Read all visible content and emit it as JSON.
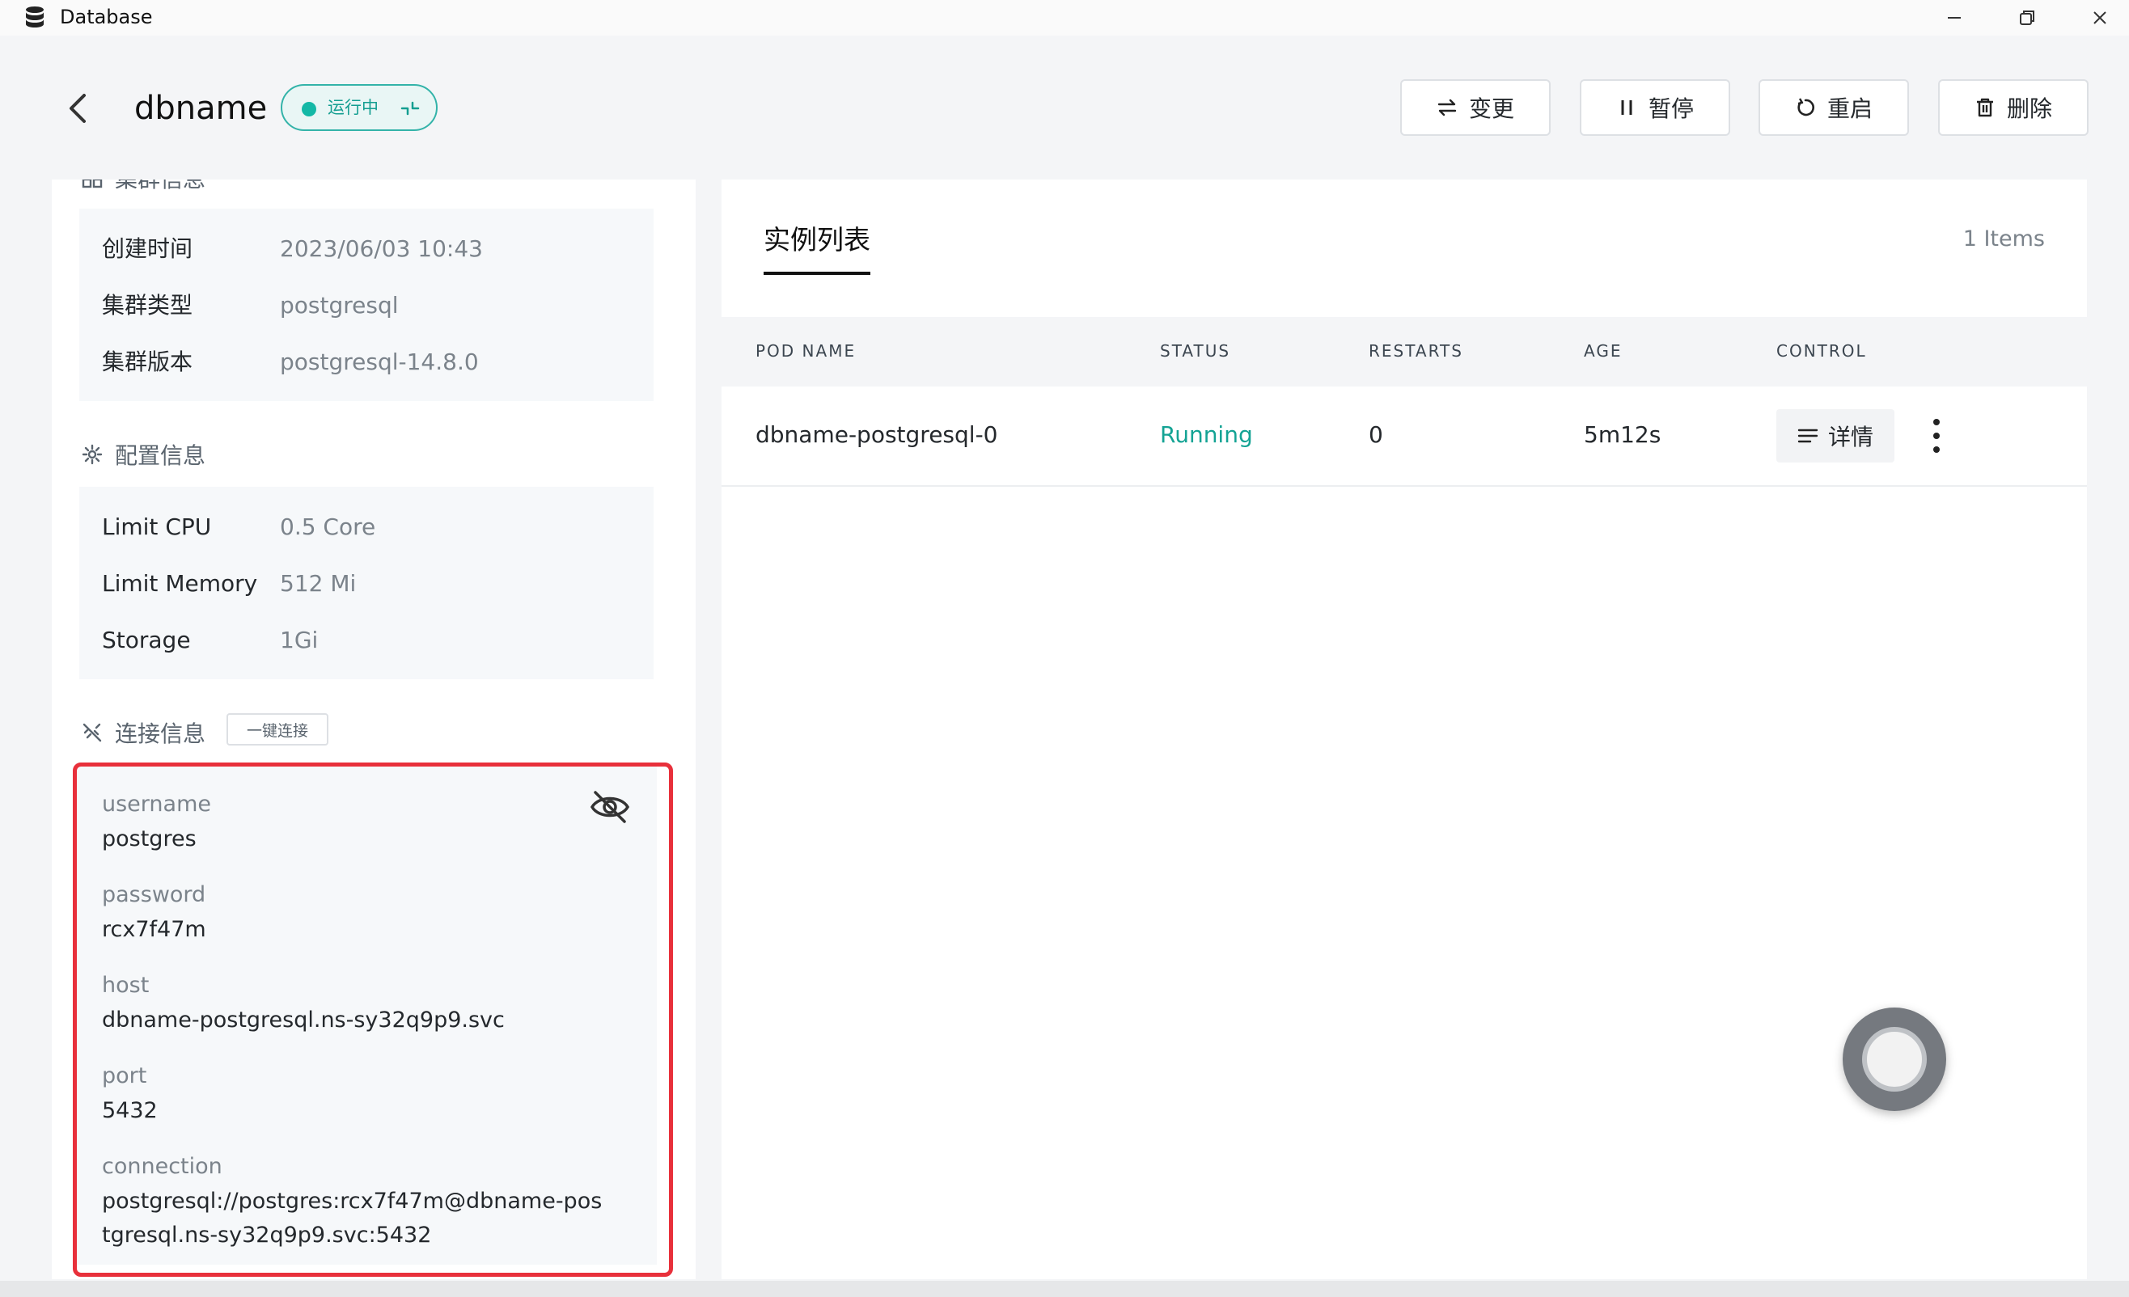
{
  "window": {
    "title": "Database"
  },
  "header": {
    "name": "dbname",
    "status": "运行中",
    "buttons": {
      "change": "变更",
      "pause": "暂停",
      "restart": "重启",
      "delete": "删除"
    }
  },
  "cluster": {
    "heading": "集群信息",
    "rows": [
      {
        "label": "创建时间",
        "value": "2023/06/03 10:43"
      },
      {
        "label": "集群类型",
        "value": "postgresql"
      },
      {
        "label": "集群版本",
        "value": "postgresql-14.8.0"
      }
    ]
  },
  "config": {
    "heading": "配置信息",
    "rows": [
      {
        "label": "Limit CPU",
        "value": "0.5 Core"
      },
      {
        "label": "Limit Memory",
        "value": "512 Mi"
      },
      {
        "label": "Storage",
        "value": "1Gi"
      }
    ]
  },
  "connection": {
    "heading": "连接信息",
    "one_click": "一键连接",
    "fields": [
      {
        "label": "username",
        "value": "postgres"
      },
      {
        "label": "password",
        "value": "rcx7f47m"
      },
      {
        "label": "host",
        "value": "dbname-postgresql.ns-sy32q9p9.svc"
      },
      {
        "label": "port",
        "value": "5432"
      },
      {
        "label": "connection",
        "value": "postgresql://postgres:rcx7f47m@dbname-postgresql.ns-sy32q9p9.svc:5432"
      }
    ]
  },
  "instances": {
    "tab": "实例列表",
    "count": "1 Items",
    "columns": [
      "POD NAME",
      "STATUS",
      "RESTARTS",
      "AGE",
      "CONTROL"
    ],
    "rows": [
      {
        "pod": "dbname-postgresql-0",
        "status": "Running",
        "restarts": "0",
        "age": "5m12s",
        "control": "详情"
      }
    ]
  },
  "colors": {
    "accent": "#14b8a6",
    "highlight": "#e8303b",
    "running": "#14a394"
  }
}
